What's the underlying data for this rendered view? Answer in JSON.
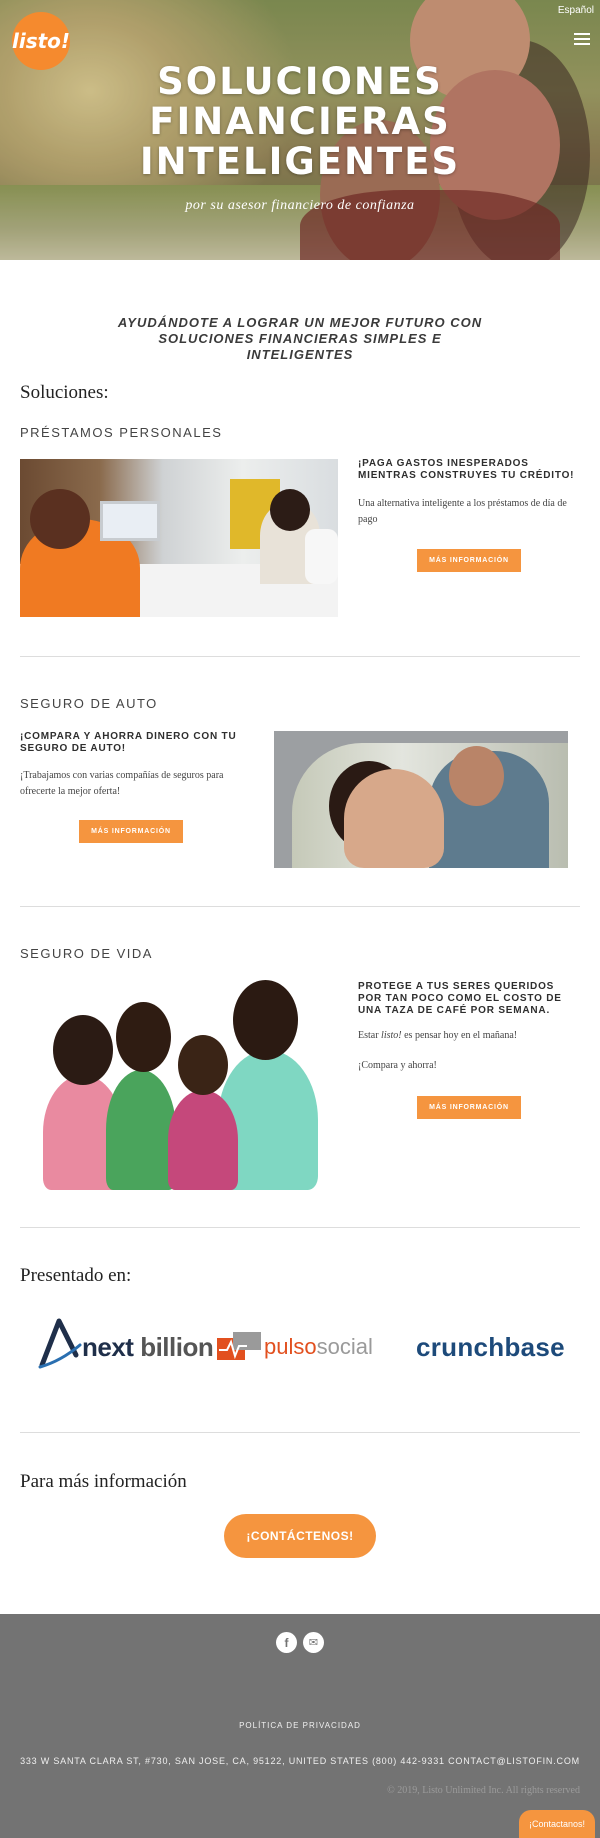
{
  "header": {
    "logo_text": "listo!",
    "language_link": "Español",
    "menu_icon": "hamburger-menu-icon"
  },
  "hero": {
    "title_lines": [
      "SOLUCIONES",
      "FINANCIERAS",
      "INTELIGENTES"
    ],
    "subtitle": "por su asesor financiero de confianza"
  },
  "tagline": "AYUDÁNDOTE A LOGRAR UN MEJOR FUTURO CON SOLUCIONES FINANCIERAS SIMPLES E INTELIGENTES",
  "solutions": {
    "heading": "Soluciones:",
    "loans": {
      "heading": "PRÉSTAMOS PERSONALES",
      "title": "¡PAGA GASTOS INESPERADOS MIENTRAS CONSTRUYES TU CRÉDITO!",
      "text": "Una alternativa inteligente a los préstamos de día de pago",
      "button": "MÁS INFORMACIÓN"
    },
    "auto": {
      "heading": "SEGURO DE AUTO",
      "title": "¡COMPARA Y AHORRA DINERO CON TU SEGURO DE AUTO!",
      "text": "¡Trabajamos con varias compañías de seguros para ofrecerte la mejor oferta!",
      "button": "MÁS INFORMACIÓN"
    },
    "life": {
      "heading": "SEGURO DE VIDA",
      "title": "PROTEGE A TUS SERES QUERIDOS POR TAN POCO COMO EL COSTO DE UNA TAZA DE CAFÉ POR SEMANA.",
      "text1_pre": "Estar ",
      "text1_em": "listo!",
      "text1_post": " es pensar hoy en el mañana!",
      "text2": "¡Compara y ahorra!",
      "button": "MÁS INFORMACIÓN"
    }
  },
  "press": {
    "heading": "Presentado en:",
    "nextbillion_a": "next",
    "nextbillion_b": " billion",
    "pulso_a": "pulso",
    "pulso_b": "social",
    "crunchbase": "crunchbase"
  },
  "contact": {
    "heading": "Para más información",
    "button": "¡CONTÁCTENOS!"
  },
  "footer": {
    "facebook_icon": "f",
    "email_icon": "✉",
    "privacy": "POLÍTICA DE PRIVACIDAD",
    "address": "333 W SANTA CLARA ST, #730, SAN JOSE, CA, 95122, UNITED STATES   (800) 442-9331   CONTACT@LISTOFIN.COM",
    "copyright": "© 2019, Listo Unlimited Inc.  All rights reserved",
    "floating_button": "¡Contactanos!"
  },
  "colors": {
    "brand_orange": "#f5953f",
    "footer_gray": "#737373"
  }
}
